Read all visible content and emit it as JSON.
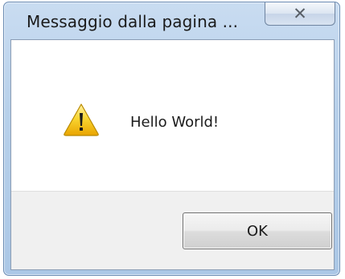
{
  "dialog": {
    "title": "Messaggio dalla pagina ...",
    "close_label": "✕",
    "icon": "warning-icon",
    "message": "Hello World!",
    "ok_label": "OK"
  },
  "colors": {
    "titlebar": "#b7d0ea",
    "frame_border": "#6a8bb3",
    "footer": "#f0f0f0",
    "warning_yellow": "#f7c400"
  }
}
